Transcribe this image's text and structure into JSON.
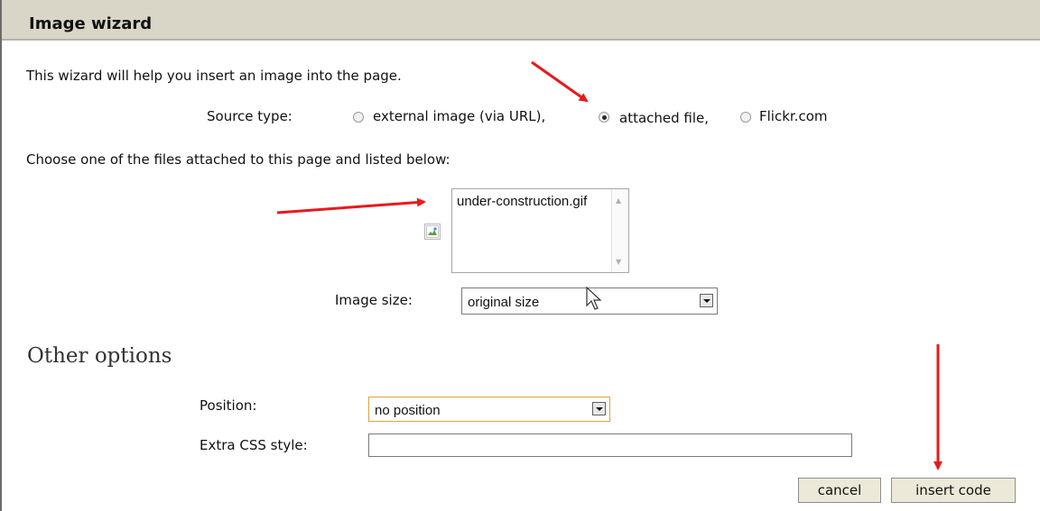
{
  "dialog": {
    "title": "Image wizard",
    "intro": "This wizard will help you insert an image into the page."
  },
  "source": {
    "label": "Source type:",
    "options": [
      "external image (via URL),",
      "attached file,",
      "Flickr.com"
    ],
    "selected_index": 1
  },
  "files": {
    "instructions": "Choose one of the files attached to this page and listed below:",
    "items": [
      "under-construction.gif"
    ]
  },
  "size": {
    "label": "Image size:",
    "value": "original size"
  },
  "other": {
    "heading": "Other options",
    "position_label": "Position:",
    "position_value": "no position",
    "css_label": "Extra CSS style:",
    "css_value": ""
  },
  "actions": {
    "cancel": "cancel",
    "insert": "insert code"
  },
  "colors": {
    "title_bar": "#d9d5c7",
    "annotation_arrow": "#e8191b",
    "position_select_border": "#e0a040"
  }
}
